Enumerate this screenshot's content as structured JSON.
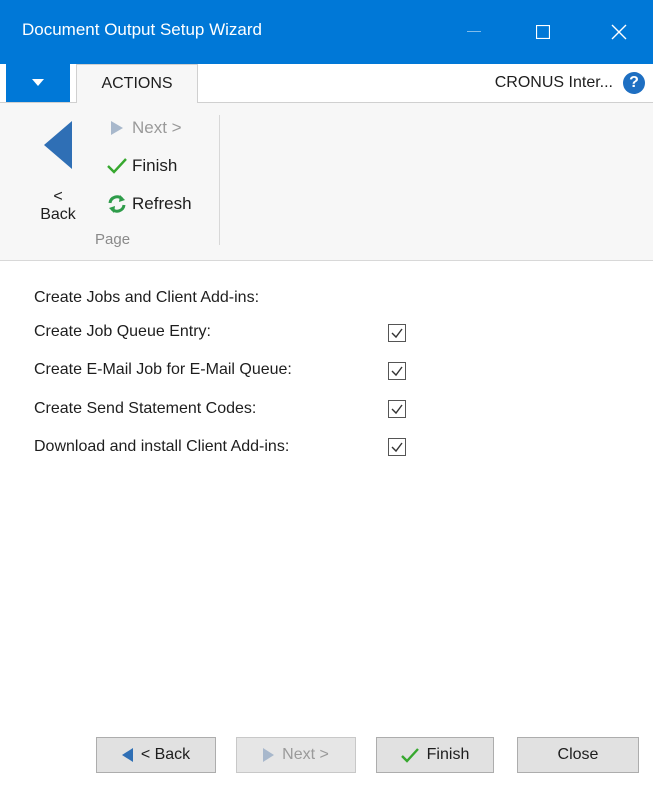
{
  "window": {
    "title": "Document Output Setup Wizard"
  },
  "ribbon_tabs": {
    "actions_tab": "ACTIONS",
    "company": "CRONUS Inter..."
  },
  "ribbon": {
    "back_label": "< Back",
    "next_label": "Next >",
    "finish_label": "Finish",
    "refresh_label": "Refresh",
    "group_label": "Page"
  },
  "form": {
    "section_heading": "Create Jobs and Client Add-ins:",
    "fields": [
      {
        "label": "Create Job Queue Entry:",
        "checked": true
      },
      {
        "label": "Create E-Mail Job for E-Mail Queue:",
        "checked": true
      },
      {
        "label": "Create Send Statement Codes:",
        "checked": true
      },
      {
        "label": "Download and install Client Add-ins:",
        "checked": true
      }
    ]
  },
  "footer": {
    "back_label": "< Back",
    "next_label": "Next >",
    "finish_label": "Finish",
    "close_label": "Close"
  },
  "colors": {
    "title_bar": "#0078d7",
    "back_arrow": "#2f6fb5",
    "finish_check": "#37a82f",
    "refresh": "#2e9c4a"
  }
}
